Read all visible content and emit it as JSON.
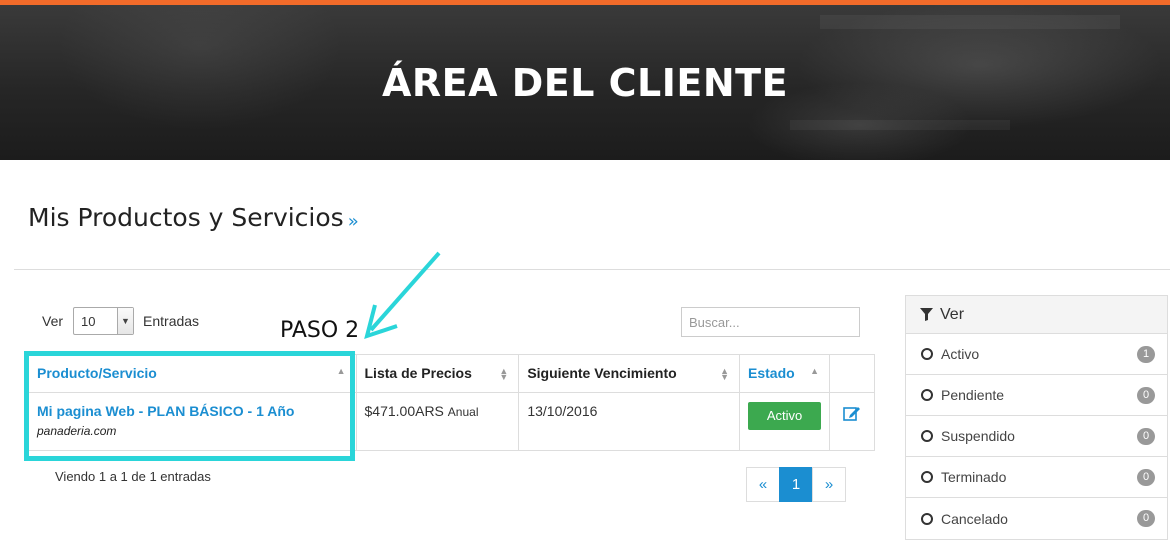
{
  "colors": {
    "top_bar": "#f26b2a",
    "link_blue": "#1b8ed1",
    "active_badge": "#3ca94f",
    "highlight": "#2ad5d9"
  },
  "hero": {
    "title": "ÁREA DEL CLIENTE"
  },
  "section": {
    "title": "Mis Productos y Servicios",
    "chevron": "»"
  },
  "length_control": {
    "prefix": "Ver",
    "value": "10",
    "suffix": "Entradas"
  },
  "search": {
    "placeholder": "Buscar..."
  },
  "annotation": {
    "label": "PASO 2"
  },
  "table": {
    "columns": [
      "Producto/Servicio",
      "Lista de Precios",
      "Siguiente Vencimiento",
      "Estado"
    ],
    "rows": [
      {
        "product": "Mi pagina Web - PLAN BÁSICO - 1 Año",
        "domain": "panaderia.com",
        "price": "$471.00ARS",
        "cycle": "Anual",
        "due": "13/10/2016",
        "status": "Activo",
        "action_icon": "edit-icon"
      }
    ]
  },
  "info": {
    "text": "Viendo 1 a 1 de 1 entradas"
  },
  "pagination": {
    "prev": "«",
    "current": "1",
    "next": "»"
  },
  "filter_panel": {
    "title": "Ver",
    "icon": "filter-icon",
    "items": [
      {
        "label": "Activo",
        "count": "1"
      },
      {
        "label": "Pendiente",
        "count": "0"
      },
      {
        "label": "Suspendido",
        "count": "0"
      },
      {
        "label": "Terminado",
        "count": "0"
      },
      {
        "label": "Cancelado",
        "count": "0"
      }
    ]
  }
}
